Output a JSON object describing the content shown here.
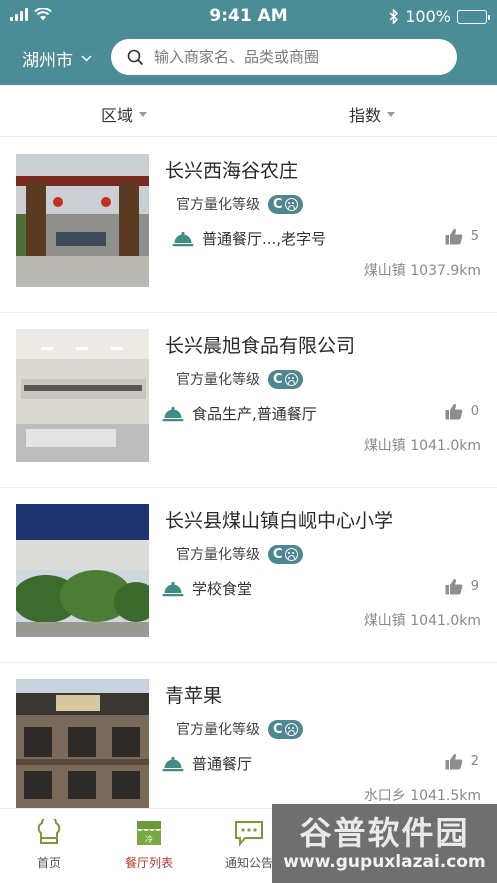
{
  "status_bar": {
    "time": "9:41 AM",
    "battery": "100%"
  },
  "header": {
    "city": "湖州市",
    "search_placeholder": "输入商家名、品类或商圈"
  },
  "filters": [
    {
      "label": "区域"
    },
    {
      "label": "指数"
    }
  ],
  "grade_label": "官方量化等级",
  "listings": [
    {
      "name": "长兴西海谷农庄",
      "grade": "C",
      "category": "普通餐厅...,老字号",
      "likes": "5",
      "location": "煤山镇 1037.9km"
    },
    {
      "name": "长兴晨旭食品有限公司",
      "grade": "C",
      "category": "食品生产,普通餐厅",
      "likes": "0",
      "location": "煤山镇 1041.0km"
    },
    {
      "name": "长兴县煤山镇白岘中心小学",
      "grade": "C",
      "category": "学校食堂",
      "likes": "9",
      "location": "煤山镇 1041.0km"
    },
    {
      "name": "青苹果",
      "grade": "C",
      "category": "普通餐厅",
      "likes": "2",
      "location": "水口乡 1041.5km"
    }
  ],
  "tabs": [
    {
      "label": "首页"
    },
    {
      "label": "餐厅列表"
    },
    {
      "label": "通知公告"
    }
  ],
  "watermark": {
    "title": "谷普软件园",
    "url": "www.gupuxlazai.com"
  },
  "colors": {
    "header": "#4a8d96",
    "badge": "#4e8791",
    "active_tab": "#b33a2f",
    "icon_teal": "#3f8d86"
  }
}
